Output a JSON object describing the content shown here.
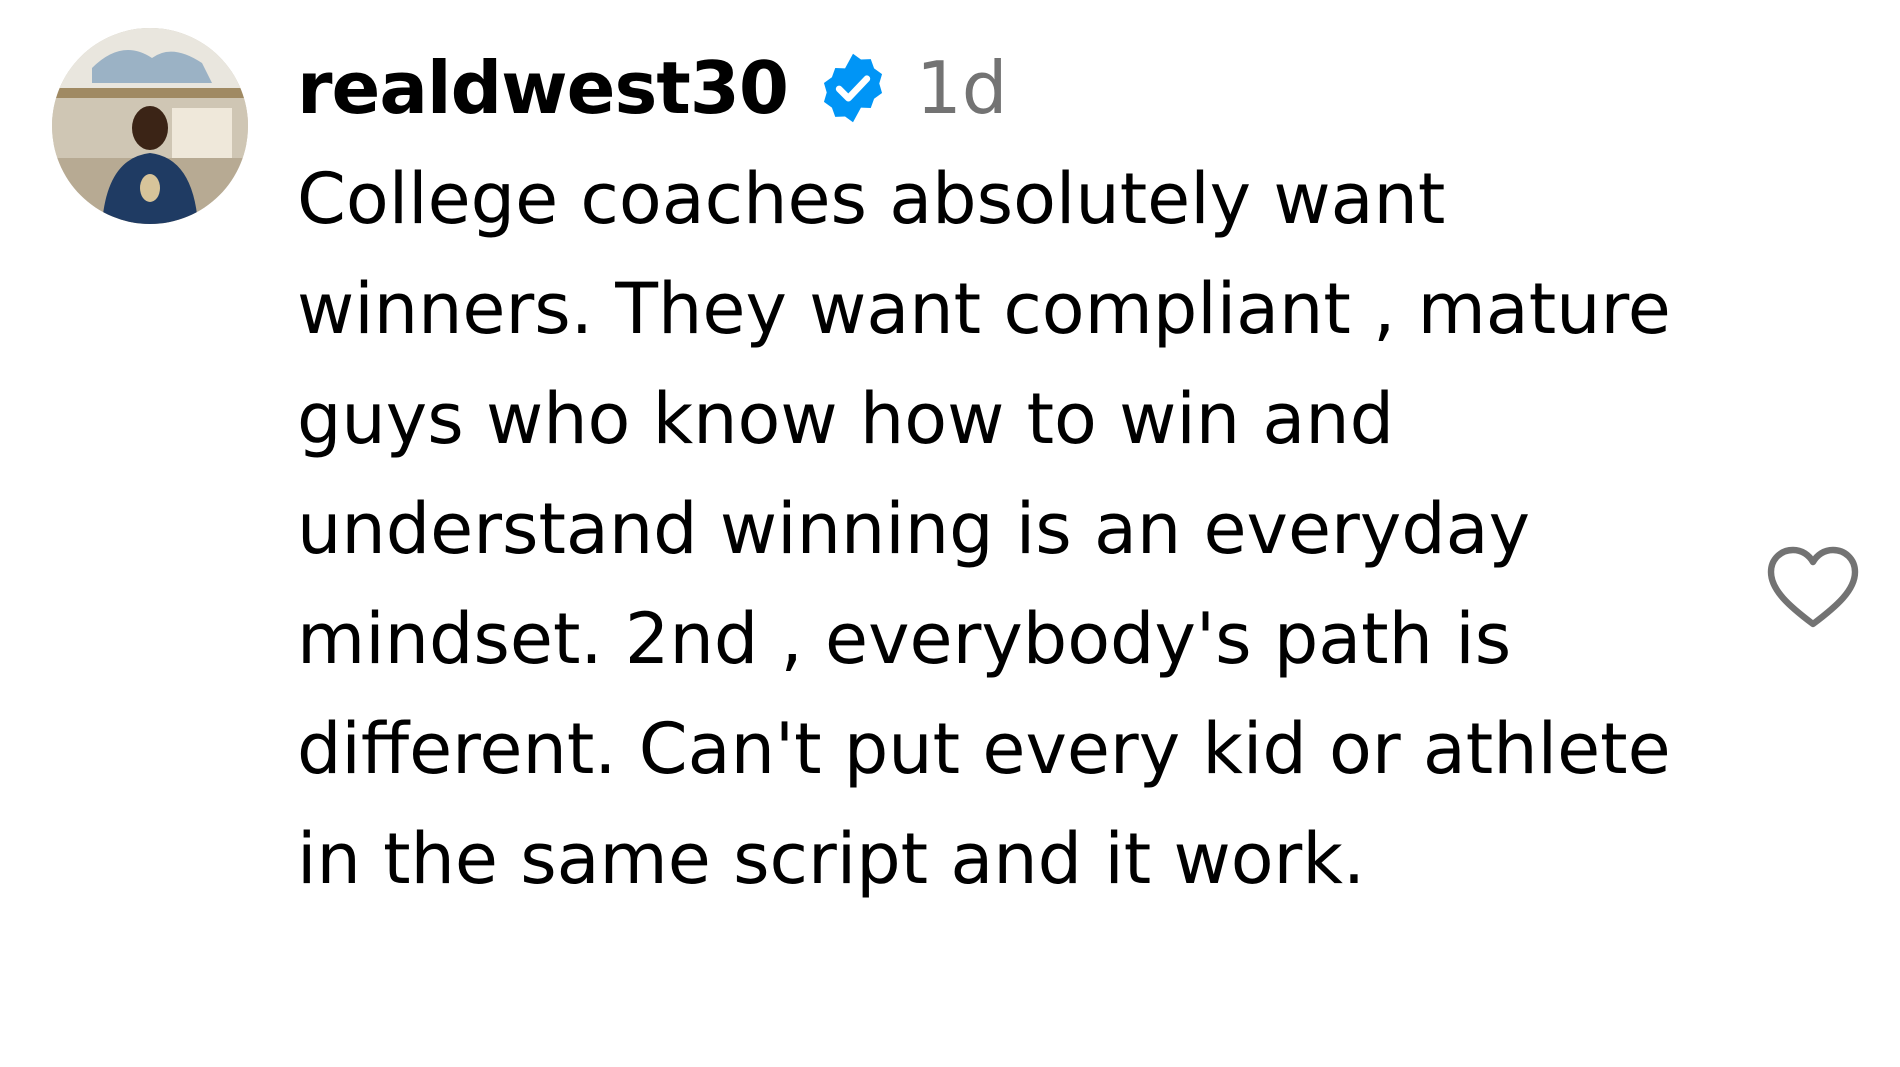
{
  "comment": {
    "username": "realdwest30",
    "verified": true,
    "timestamp": "1d",
    "text": "College coaches absolutely want winners. They want compliant , mature guys who know how to win and understand winning is an everyday mindset. 2nd , everybody's path is different. Can't put every kid or athlete in the same script and it work."
  },
  "icons": {
    "verified": "verified-badge-icon",
    "like": "heart-outline-icon",
    "avatar": "user-avatar-photo"
  },
  "colors": {
    "verified_blue": "#0095F6",
    "timestamp_gray": "#737373",
    "heart_outline": "#737373"
  }
}
